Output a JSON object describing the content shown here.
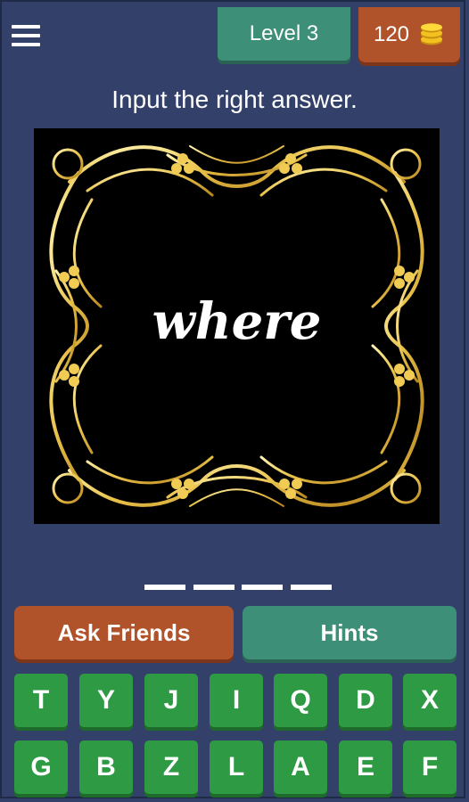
{
  "header": {
    "menu_icon": "hamburger-menu-icon",
    "level_label": "Level 3",
    "coins": "120",
    "coin_icon": "coin-stack-icon"
  },
  "prompt": {
    "instruction": "Input the right answer."
  },
  "puzzle": {
    "word": "where",
    "frame_color": "#e8c14a",
    "background": "#000000"
  },
  "answer": {
    "letter_count": 4,
    "filled": [
      "",
      "",
      "",
      ""
    ]
  },
  "actions": {
    "ask_friends_label": "Ask Friends",
    "hints_label": "Hints"
  },
  "keyboard": {
    "row1": [
      "T",
      "Y",
      "J",
      "I",
      "Q",
      "D",
      "X"
    ],
    "row2": [
      "G",
      "B",
      "Z",
      "L",
      "A",
      "E",
      "F"
    ]
  },
  "colors": {
    "background": "#33416a",
    "level_green": "#3e8f77",
    "coins_orange": "#b0532b",
    "key_green": "#2e9a43"
  }
}
